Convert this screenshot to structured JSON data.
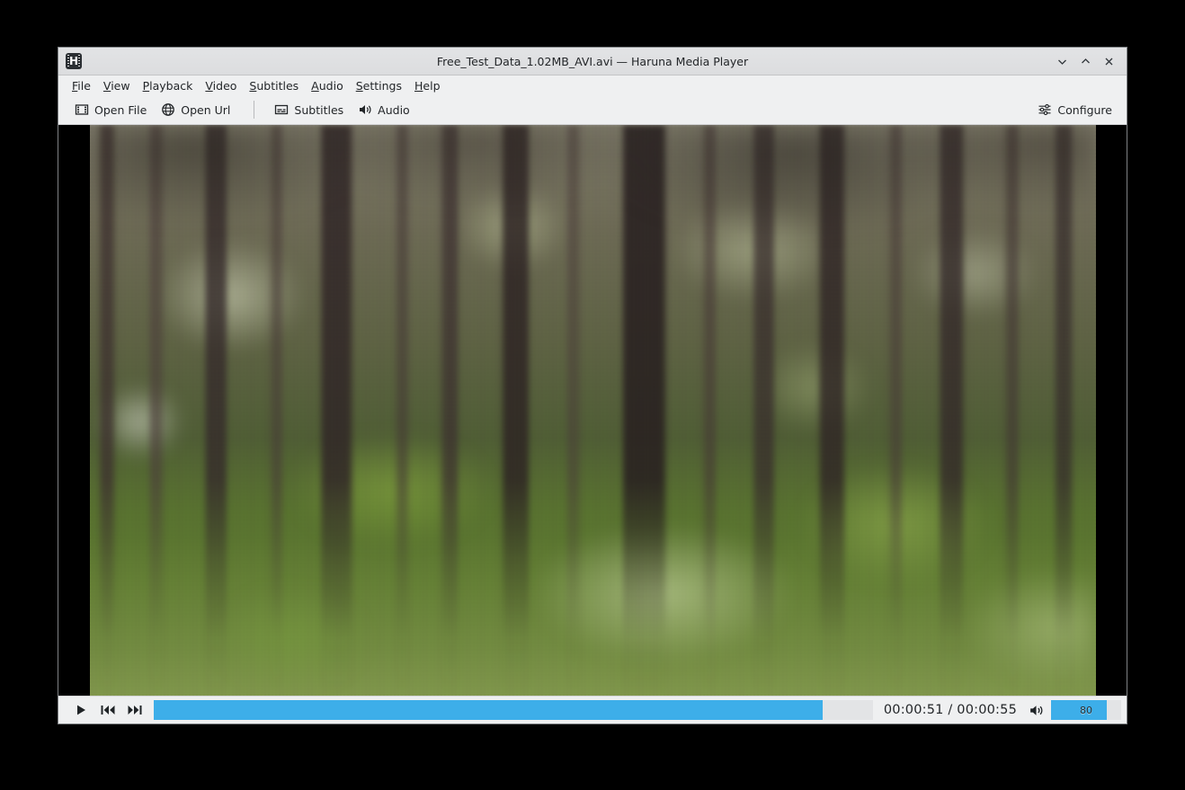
{
  "window": {
    "title": "Free_Test_Data_1.02MB_AVI.avi — Haruna Media Player",
    "app_icon": "haruna-film-icon",
    "accent_color": "#3daee9",
    "background_color": "#eff0f1",
    "text_color": "#232629",
    "controls": {
      "minimize_label": "minimize-icon",
      "maximize_label": "maximize-icon",
      "close_label": "close-icon"
    }
  },
  "menubar": {
    "items": [
      {
        "label": "File",
        "mnemonic": "F",
        "rest": "ile"
      },
      {
        "label": "View",
        "mnemonic": "V",
        "rest": "iew"
      },
      {
        "label": "Playback",
        "mnemonic": "P",
        "rest": "layback"
      },
      {
        "label": "Video",
        "mnemonic": "V",
        "rest": "ideo"
      },
      {
        "label": "Subtitles",
        "mnemonic": "S",
        "rest": "ubtitles"
      },
      {
        "label": "Audio",
        "mnemonic": "A",
        "rest": "udio"
      },
      {
        "label": "Settings",
        "mnemonic": "S",
        "rest": "ettings"
      },
      {
        "label": "Help",
        "mnemonic": "H",
        "rest": "elp"
      }
    ]
  },
  "toolbar": {
    "open_file_label": "Open File",
    "open_file_icon": "film-strip-icon",
    "open_url_label": "Open Url",
    "open_url_icon": "globe-icon",
    "subtitles_label": "Subtitles",
    "subtitles_icon": "subtitle-box-icon",
    "audio_label": "Audio",
    "audio_icon": "speaker-icon",
    "configure_label": "Configure",
    "configure_icon": "sliders-icon"
  },
  "player": {
    "play_button": "play-icon",
    "previous_button": "skip-backward-icon",
    "next_button": "skip-forward-icon",
    "position": "00:00:51",
    "duration": "00:00:55",
    "time_display": "00:00:51 / 00:00:55",
    "seek_percent": 93,
    "volume_icon": "volume-medium-icon",
    "volume_value": "80",
    "volume_percent": 80
  },
  "video": {
    "content_description": "Blurry low-bitrate forest footage: dark vertical tree trunks over sunlit green grass",
    "letterbox_color": "#000000"
  }
}
